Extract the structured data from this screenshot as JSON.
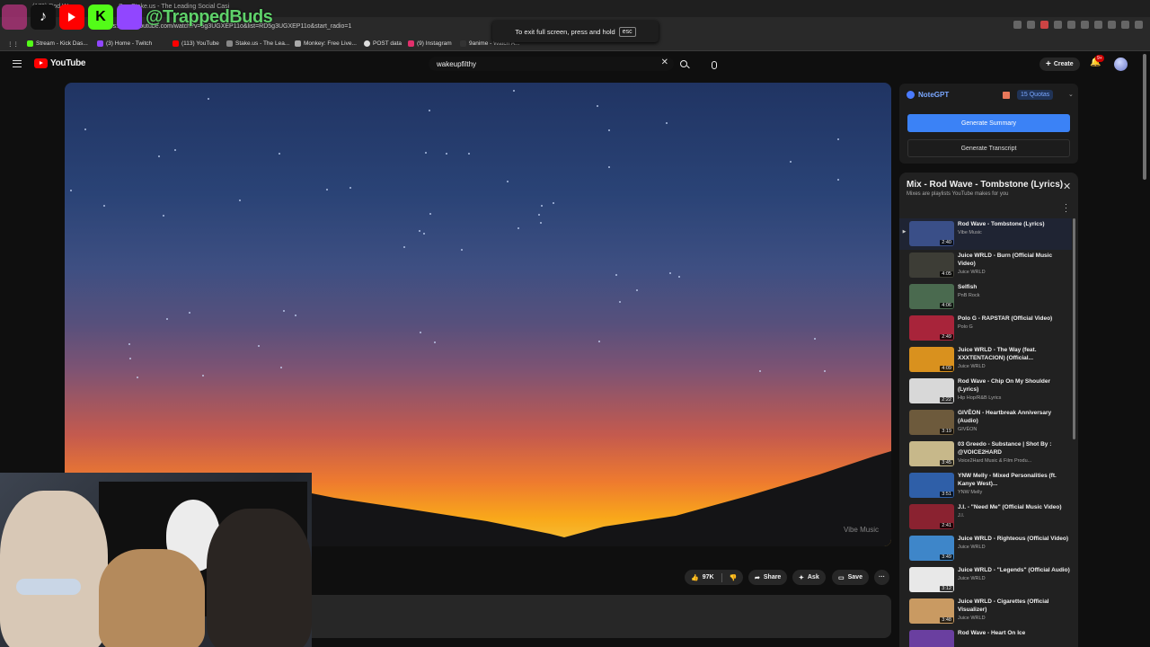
{
  "browser": {
    "tabs": [
      "(179) Rod Wave -",
      "S",
      "Stake.us - The Leading Social Casi"
    ],
    "url": "https://www.youtube.com/watch?v=5g3UGXEP11o&list=RD5g3UGXEP11o&start_radio=1",
    "overlay_handle": "@TrappedBuds",
    "bookmarks": [
      "Stream - Kick Das...",
      "(3) Home - Twitch",
      "(113) YouTube",
      "Stake.us - The Lea...",
      "Monkey: Free Live...",
      "POST data",
      "(9) Instagram",
      "9anime - Watch A..."
    ],
    "fullscreen_message": "To exit full screen, press and hold",
    "fullscreen_key": "esc"
  },
  "header": {
    "logo": "YouTube",
    "search_value": "wakeupfilthy",
    "create_label": "Create",
    "notif_count": "9+"
  },
  "video": {
    "watermark": "Vibe Music",
    "like_count": "97K",
    "share_label": "Share",
    "ask_label": "Ask",
    "save_label": "Save"
  },
  "notegpt": {
    "title": "NoteGPT",
    "quotas": "15 Quotas",
    "summary_button": "Generate Summary",
    "transcript_button": "Generate Transcript"
  },
  "playlist": {
    "title": "Mix - Rod Wave - Tombstone (Lyrics)",
    "subtitle": "Mixes are playlists YouTube makes for you",
    "items": [
      {
        "title": "Rod Wave - Tombstone (Lyrics)",
        "channel": "Vibe Music",
        "duration": "2:40",
        "color": "#3a4f88"
      },
      {
        "title": "Juice WRLD - Burn (Official Music Video)",
        "channel": "Juice WRLD",
        "duration": "4:05",
        "color": "#3d3d36"
      },
      {
        "title": "Selfish",
        "channel": "PnB Rock",
        "duration": "4:06",
        "color": "#4a6a4f"
      },
      {
        "title": "Polo G - RAPSTAR (Official Video)",
        "channel": "Polo G",
        "duration": "2:49",
        "color": "#a8243a"
      },
      {
        "title": "Juice WRLD - The Way (feat. XXXTENTACION) (Official...",
        "channel": "Juice WRLD",
        "duration": "4:09",
        "color": "#d9911e"
      },
      {
        "title": "Rod Wave - Chip On My Shoulder (Lyrics)",
        "channel": "Hip Hop/R&B Lyrics",
        "duration": "2:22",
        "color": "#d8d8d8"
      },
      {
        "title": "GIVĒON - Heartbreak Anniversary (Audio)",
        "channel": "GIVĒON",
        "duration": "3:19",
        "color": "#6d5a3c"
      },
      {
        "title": "03 Greedo - Substance | Shot By : @VOICE2HARD",
        "channel": "Voice2Hard Music & Film Produ...",
        "duration": "3:45",
        "color": "#c7b88a"
      },
      {
        "title": "YNW Melly - Mixed Personalities (ft. Kanye West)...",
        "channel": "YNW Melly",
        "duration": "3:51",
        "color": "#2f5fa8"
      },
      {
        "title": "J.I. - \"Need Me\" (Official Music Video)",
        "channel": "J.I.",
        "duration": "2:41",
        "color": "#8a2230"
      },
      {
        "title": "Juice WRLD - Righteous (Official Video)",
        "channel": "Juice WRLD",
        "duration": "3:49",
        "color": "#3e86c9"
      },
      {
        "title": "Juice WRLD - \"Legends\" (Official Audio)",
        "channel": "Juice WRLD",
        "duration": "3:12",
        "color": "#e8e8e8"
      },
      {
        "title": "Juice WRLD - Cigarettes (Official Visualizer)",
        "channel": "Juice WRLD",
        "duration": "3:48",
        "color": "#c99a62"
      },
      {
        "title": "Rod Wave - Heart On Ice",
        "channel": "",
        "duration": "",
        "color": "#6a3fa0"
      }
    ]
  }
}
